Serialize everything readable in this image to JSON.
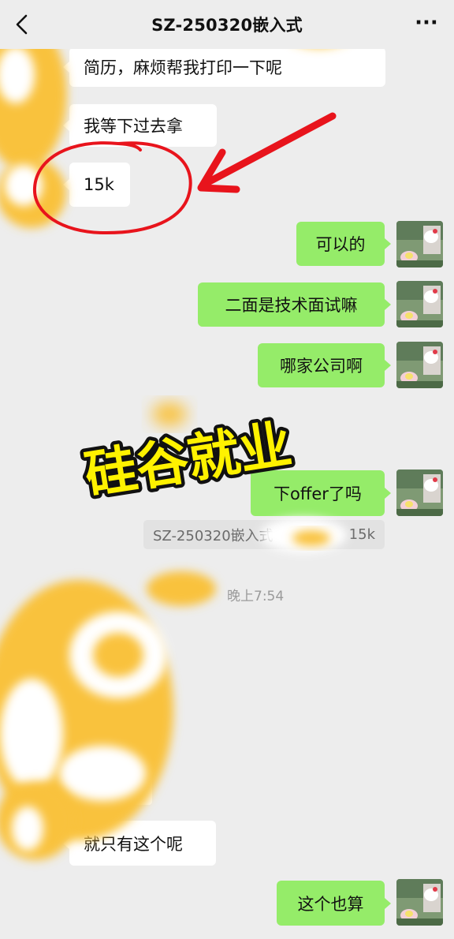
{
  "header": {
    "title": "SZ-250320嵌入式",
    "more_label": "···"
  },
  "messages": [
    {
      "side": "in",
      "text": "简历，麻烦帮我打印一下呢"
    },
    {
      "side": "in",
      "text": "我等下过去拿"
    },
    {
      "side": "in",
      "text": "15k"
    },
    {
      "side": "out",
      "text": "可以的"
    },
    {
      "side": "out",
      "text": "二面是技术面试嘛"
    },
    {
      "side": "out",
      "text": "哪家公司啊"
    },
    {
      "side": "out",
      "text": "下offer了吗"
    },
    {
      "side": "in",
      "text": "就只有这个呢"
    },
    {
      "side": "out",
      "text": "这个也算"
    }
  ],
  "quote": {
    "sender": "SZ-250320嵌入式",
    "text": "15k"
  },
  "timestamp": "晚上7:54",
  "watermark": {
    "text": "硅谷就业",
    "fill": "#fff200",
    "stroke": "#111111"
  },
  "annotation": {
    "color": "#e8141c"
  },
  "colors": {
    "background": "#ededed",
    "incoming_bubble": "#ffffff",
    "outgoing_bubble": "#95ec69",
    "blur_yellow": "#f9c23c"
  }
}
